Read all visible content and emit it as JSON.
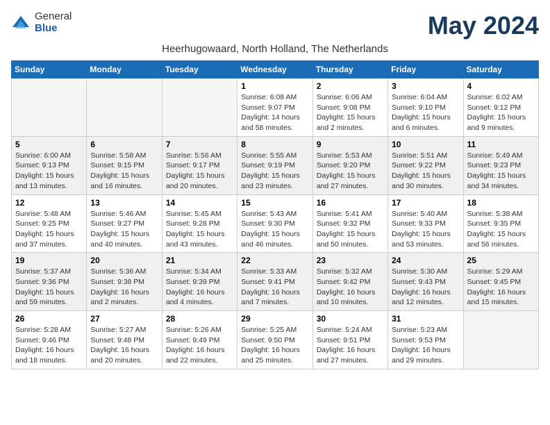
{
  "logo": {
    "general": "General",
    "blue": "Blue"
  },
  "title": "May 2024",
  "subtitle": "Heerhugowaard, North Holland, The Netherlands",
  "days_of_week": [
    "Sunday",
    "Monday",
    "Tuesday",
    "Wednesday",
    "Thursday",
    "Friday",
    "Saturday"
  ],
  "weeks": [
    [
      {
        "day": "",
        "info": ""
      },
      {
        "day": "",
        "info": ""
      },
      {
        "day": "",
        "info": ""
      },
      {
        "day": "1",
        "info": "Sunrise: 6:08 AM\nSunset: 9:07 PM\nDaylight: 14 hours\nand 58 minutes."
      },
      {
        "day": "2",
        "info": "Sunrise: 6:06 AM\nSunset: 9:08 PM\nDaylight: 15 hours\nand 2 minutes."
      },
      {
        "day": "3",
        "info": "Sunrise: 6:04 AM\nSunset: 9:10 PM\nDaylight: 15 hours\nand 6 minutes."
      },
      {
        "day": "4",
        "info": "Sunrise: 6:02 AM\nSunset: 9:12 PM\nDaylight: 15 hours\nand 9 minutes."
      }
    ],
    [
      {
        "day": "5",
        "info": "Sunrise: 6:00 AM\nSunset: 9:13 PM\nDaylight: 15 hours\nand 13 minutes."
      },
      {
        "day": "6",
        "info": "Sunrise: 5:58 AM\nSunset: 9:15 PM\nDaylight: 15 hours\nand 16 minutes."
      },
      {
        "day": "7",
        "info": "Sunrise: 5:56 AM\nSunset: 9:17 PM\nDaylight: 15 hours\nand 20 minutes."
      },
      {
        "day": "8",
        "info": "Sunrise: 5:55 AM\nSunset: 9:19 PM\nDaylight: 15 hours\nand 23 minutes."
      },
      {
        "day": "9",
        "info": "Sunrise: 5:53 AM\nSunset: 9:20 PM\nDaylight: 15 hours\nand 27 minutes."
      },
      {
        "day": "10",
        "info": "Sunrise: 5:51 AM\nSunset: 9:22 PM\nDaylight: 15 hours\nand 30 minutes."
      },
      {
        "day": "11",
        "info": "Sunrise: 5:49 AM\nSunset: 9:23 PM\nDaylight: 15 hours\nand 34 minutes."
      }
    ],
    [
      {
        "day": "12",
        "info": "Sunrise: 5:48 AM\nSunset: 9:25 PM\nDaylight: 15 hours\nand 37 minutes."
      },
      {
        "day": "13",
        "info": "Sunrise: 5:46 AM\nSunset: 9:27 PM\nDaylight: 15 hours\nand 40 minutes."
      },
      {
        "day": "14",
        "info": "Sunrise: 5:45 AM\nSunset: 9:28 PM\nDaylight: 15 hours\nand 43 minutes."
      },
      {
        "day": "15",
        "info": "Sunrise: 5:43 AM\nSunset: 9:30 PM\nDaylight: 15 hours\nand 46 minutes."
      },
      {
        "day": "16",
        "info": "Sunrise: 5:41 AM\nSunset: 9:32 PM\nDaylight: 15 hours\nand 50 minutes."
      },
      {
        "day": "17",
        "info": "Sunrise: 5:40 AM\nSunset: 9:33 PM\nDaylight: 15 hours\nand 53 minutes."
      },
      {
        "day": "18",
        "info": "Sunrise: 5:38 AM\nSunset: 9:35 PM\nDaylight: 15 hours\nand 56 minutes."
      }
    ],
    [
      {
        "day": "19",
        "info": "Sunrise: 5:37 AM\nSunset: 9:36 PM\nDaylight: 15 hours\nand 59 minutes."
      },
      {
        "day": "20",
        "info": "Sunrise: 5:36 AM\nSunset: 9:38 PM\nDaylight: 16 hours\nand 2 minutes."
      },
      {
        "day": "21",
        "info": "Sunrise: 5:34 AM\nSunset: 9:39 PM\nDaylight: 16 hours\nand 4 minutes."
      },
      {
        "day": "22",
        "info": "Sunrise: 5:33 AM\nSunset: 9:41 PM\nDaylight: 16 hours\nand 7 minutes."
      },
      {
        "day": "23",
        "info": "Sunrise: 5:32 AM\nSunset: 9:42 PM\nDaylight: 16 hours\nand 10 minutes."
      },
      {
        "day": "24",
        "info": "Sunrise: 5:30 AM\nSunset: 9:43 PM\nDaylight: 16 hours\nand 12 minutes."
      },
      {
        "day": "25",
        "info": "Sunrise: 5:29 AM\nSunset: 9:45 PM\nDaylight: 16 hours\nand 15 minutes."
      }
    ],
    [
      {
        "day": "26",
        "info": "Sunrise: 5:28 AM\nSunset: 9:46 PM\nDaylight: 16 hours\nand 18 minutes."
      },
      {
        "day": "27",
        "info": "Sunrise: 5:27 AM\nSunset: 9:48 PM\nDaylight: 16 hours\nand 20 minutes."
      },
      {
        "day": "28",
        "info": "Sunrise: 5:26 AM\nSunset: 9:49 PM\nDaylight: 16 hours\nand 22 minutes."
      },
      {
        "day": "29",
        "info": "Sunrise: 5:25 AM\nSunset: 9:50 PM\nDaylight: 16 hours\nand 25 minutes."
      },
      {
        "day": "30",
        "info": "Sunrise: 5:24 AM\nSunset: 9:51 PM\nDaylight: 16 hours\nand 27 minutes."
      },
      {
        "day": "31",
        "info": "Sunrise: 5:23 AM\nSunset: 9:53 PM\nDaylight: 16 hours\nand 29 minutes."
      },
      {
        "day": "",
        "info": ""
      }
    ]
  ]
}
